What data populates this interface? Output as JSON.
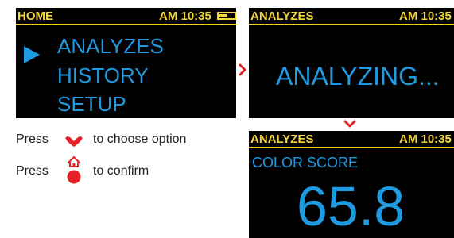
{
  "colors": {
    "screen_bg": "#000000",
    "status_text": "#f4d63a",
    "accent_blue": "#1f9ae0",
    "control_red": "#e8202a"
  },
  "screen_home": {
    "title": "HOME",
    "time": "AM 10:35",
    "menu": [
      "ANALYZES",
      "HISTORY",
      "SETUP"
    ],
    "selected_index": 0
  },
  "screen_analyzing": {
    "title": "ANALYZES",
    "time": "AM 10:35",
    "message": "ANALYZING..."
  },
  "screen_result": {
    "title": "ANALYZES",
    "time": "AM 10:35",
    "label": "COLOR SCORE",
    "value": "65.8"
  },
  "instructions": {
    "press_word": "Press",
    "choose_text": "to choose option",
    "confirm_text": "to confirm",
    "choose_icon": "chevron-down-icon",
    "confirm_icon": "home-button-icon"
  }
}
